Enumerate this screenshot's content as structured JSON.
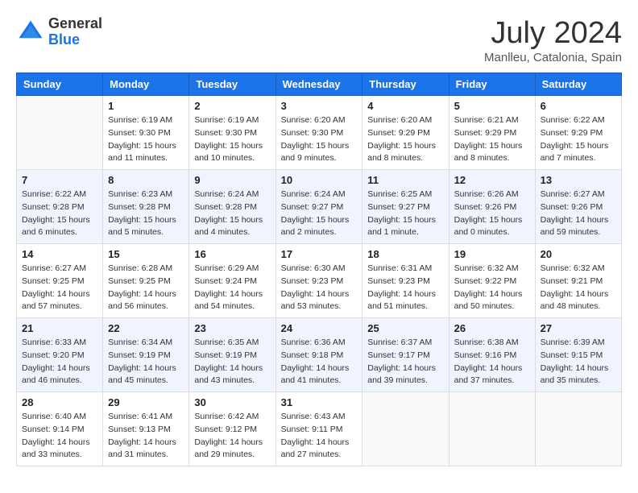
{
  "header": {
    "logo_general": "General",
    "logo_blue": "Blue",
    "month_year": "July 2024",
    "location": "Manlleu, Catalonia, Spain"
  },
  "weekdays": [
    "Sunday",
    "Monday",
    "Tuesday",
    "Wednesday",
    "Thursday",
    "Friday",
    "Saturday"
  ],
  "weeks": [
    [
      {
        "day": "",
        "sunrise": "",
        "sunset": "",
        "daylight": ""
      },
      {
        "day": "1",
        "sunrise": "Sunrise: 6:19 AM",
        "sunset": "Sunset: 9:30 PM",
        "daylight": "Daylight: 15 hours and 11 minutes."
      },
      {
        "day": "2",
        "sunrise": "Sunrise: 6:19 AM",
        "sunset": "Sunset: 9:30 PM",
        "daylight": "Daylight: 15 hours and 10 minutes."
      },
      {
        "day": "3",
        "sunrise": "Sunrise: 6:20 AM",
        "sunset": "Sunset: 9:30 PM",
        "daylight": "Daylight: 15 hours and 9 minutes."
      },
      {
        "day": "4",
        "sunrise": "Sunrise: 6:20 AM",
        "sunset": "Sunset: 9:29 PM",
        "daylight": "Daylight: 15 hours and 8 minutes."
      },
      {
        "day": "5",
        "sunrise": "Sunrise: 6:21 AM",
        "sunset": "Sunset: 9:29 PM",
        "daylight": "Daylight: 15 hours and 8 minutes."
      },
      {
        "day": "6",
        "sunrise": "Sunrise: 6:22 AM",
        "sunset": "Sunset: 9:29 PM",
        "daylight": "Daylight: 15 hours and 7 minutes."
      }
    ],
    [
      {
        "day": "7",
        "sunrise": "Sunrise: 6:22 AM",
        "sunset": "Sunset: 9:28 PM",
        "daylight": "Daylight: 15 hours and 6 minutes."
      },
      {
        "day": "8",
        "sunrise": "Sunrise: 6:23 AM",
        "sunset": "Sunset: 9:28 PM",
        "daylight": "Daylight: 15 hours and 5 minutes."
      },
      {
        "day": "9",
        "sunrise": "Sunrise: 6:24 AM",
        "sunset": "Sunset: 9:28 PM",
        "daylight": "Daylight: 15 hours and 4 minutes."
      },
      {
        "day": "10",
        "sunrise": "Sunrise: 6:24 AM",
        "sunset": "Sunset: 9:27 PM",
        "daylight": "Daylight: 15 hours and 2 minutes."
      },
      {
        "day": "11",
        "sunrise": "Sunrise: 6:25 AM",
        "sunset": "Sunset: 9:27 PM",
        "daylight": "Daylight: 15 hours and 1 minute."
      },
      {
        "day": "12",
        "sunrise": "Sunrise: 6:26 AM",
        "sunset": "Sunset: 9:26 PM",
        "daylight": "Daylight: 15 hours and 0 minutes."
      },
      {
        "day": "13",
        "sunrise": "Sunrise: 6:27 AM",
        "sunset": "Sunset: 9:26 PM",
        "daylight": "Daylight: 14 hours and 59 minutes."
      }
    ],
    [
      {
        "day": "14",
        "sunrise": "Sunrise: 6:27 AM",
        "sunset": "Sunset: 9:25 PM",
        "daylight": "Daylight: 14 hours and 57 minutes."
      },
      {
        "day": "15",
        "sunrise": "Sunrise: 6:28 AM",
        "sunset": "Sunset: 9:25 PM",
        "daylight": "Daylight: 14 hours and 56 minutes."
      },
      {
        "day": "16",
        "sunrise": "Sunrise: 6:29 AM",
        "sunset": "Sunset: 9:24 PM",
        "daylight": "Daylight: 14 hours and 54 minutes."
      },
      {
        "day": "17",
        "sunrise": "Sunrise: 6:30 AM",
        "sunset": "Sunset: 9:23 PM",
        "daylight": "Daylight: 14 hours and 53 minutes."
      },
      {
        "day": "18",
        "sunrise": "Sunrise: 6:31 AM",
        "sunset": "Sunset: 9:23 PM",
        "daylight": "Daylight: 14 hours and 51 minutes."
      },
      {
        "day": "19",
        "sunrise": "Sunrise: 6:32 AM",
        "sunset": "Sunset: 9:22 PM",
        "daylight": "Daylight: 14 hours and 50 minutes."
      },
      {
        "day": "20",
        "sunrise": "Sunrise: 6:32 AM",
        "sunset": "Sunset: 9:21 PM",
        "daylight": "Daylight: 14 hours and 48 minutes."
      }
    ],
    [
      {
        "day": "21",
        "sunrise": "Sunrise: 6:33 AM",
        "sunset": "Sunset: 9:20 PM",
        "daylight": "Daylight: 14 hours and 46 minutes."
      },
      {
        "day": "22",
        "sunrise": "Sunrise: 6:34 AM",
        "sunset": "Sunset: 9:19 PM",
        "daylight": "Daylight: 14 hours and 45 minutes."
      },
      {
        "day": "23",
        "sunrise": "Sunrise: 6:35 AM",
        "sunset": "Sunset: 9:19 PM",
        "daylight": "Daylight: 14 hours and 43 minutes."
      },
      {
        "day": "24",
        "sunrise": "Sunrise: 6:36 AM",
        "sunset": "Sunset: 9:18 PM",
        "daylight": "Daylight: 14 hours and 41 minutes."
      },
      {
        "day": "25",
        "sunrise": "Sunrise: 6:37 AM",
        "sunset": "Sunset: 9:17 PM",
        "daylight": "Daylight: 14 hours and 39 minutes."
      },
      {
        "day": "26",
        "sunrise": "Sunrise: 6:38 AM",
        "sunset": "Sunset: 9:16 PM",
        "daylight": "Daylight: 14 hours and 37 minutes."
      },
      {
        "day": "27",
        "sunrise": "Sunrise: 6:39 AM",
        "sunset": "Sunset: 9:15 PM",
        "daylight": "Daylight: 14 hours and 35 minutes."
      }
    ],
    [
      {
        "day": "28",
        "sunrise": "Sunrise: 6:40 AM",
        "sunset": "Sunset: 9:14 PM",
        "daylight": "Daylight: 14 hours and 33 minutes."
      },
      {
        "day": "29",
        "sunrise": "Sunrise: 6:41 AM",
        "sunset": "Sunset: 9:13 PM",
        "daylight": "Daylight: 14 hours and 31 minutes."
      },
      {
        "day": "30",
        "sunrise": "Sunrise: 6:42 AM",
        "sunset": "Sunset: 9:12 PM",
        "daylight": "Daylight: 14 hours and 29 minutes."
      },
      {
        "day": "31",
        "sunrise": "Sunrise: 6:43 AM",
        "sunset": "Sunset: 9:11 PM",
        "daylight": "Daylight: 14 hours and 27 minutes."
      },
      {
        "day": "",
        "sunrise": "",
        "sunset": "",
        "daylight": ""
      },
      {
        "day": "",
        "sunrise": "",
        "sunset": "",
        "daylight": ""
      },
      {
        "day": "",
        "sunrise": "",
        "sunset": "",
        "daylight": ""
      }
    ]
  ]
}
